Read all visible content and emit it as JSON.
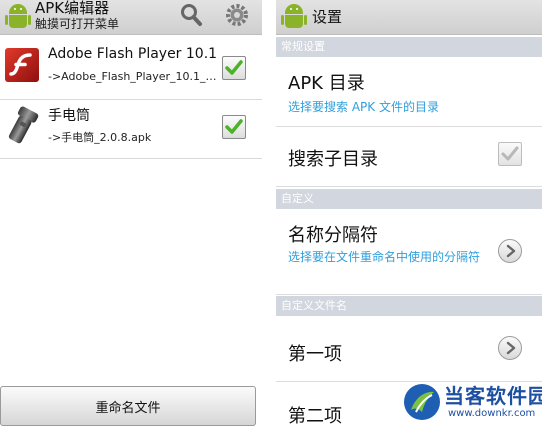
{
  "left": {
    "app_title": "APK编辑器",
    "app_subtitle": "触摸可打开菜单",
    "files": [
      {
        "name": "Adobe Flash Player 10.1",
        "path": "->Adobe_Flash_Player_10.1_10...",
        "checked": true,
        "icon": "flash-player-icon"
      },
      {
        "name": "手电筒",
        "path": "->手电筒_2.0.8.apk",
        "checked": true,
        "icon": "flashlight-icon"
      }
    ],
    "rename_button": "重命名文件"
  },
  "right": {
    "title": "设置",
    "sections": [
      {
        "header": "常规设置"
      },
      {
        "header": "自定义"
      },
      {
        "header": "自定义文件名"
      }
    ],
    "prefs": {
      "apk_dir": {
        "title": "APK 目录",
        "summary": "选择要搜索 APK 文件的目录"
      },
      "search_subdirs": {
        "title": "搜索子目录",
        "checked": true
      },
      "separator": {
        "title": "名称分隔符",
        "summary": "选择要在文件重命名中使用的分隔符"
      },
      "item1": {
        "title": "第一项"
      },
      "item2": {
        "title": "第二项"
      }
    }
  },
  "watermark": {
    "name": "当客软件园",
    "url": "www.downkr.com"
  },
  "colors": {
    "accent_blue": "#2f9fdc",
    "section_header": "#d2d6de",
    "check_green": "#4cb22a",
    "android_green": "#8ab32a"
  }
}
